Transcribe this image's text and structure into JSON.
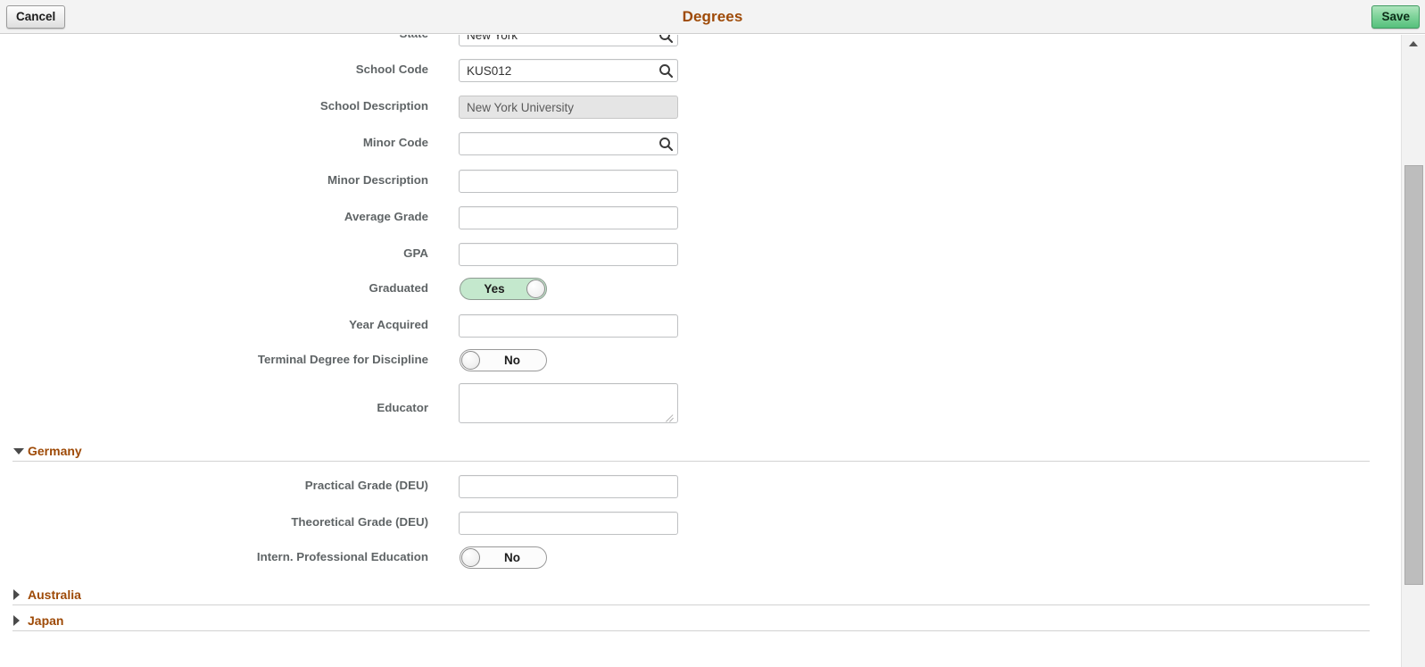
{
  "window": {
    "title": "Degrees",
    "cancel_label": "Cancel",
    "save_label": "Save"
  },
  "form": {
    "fields": [
      {
        "label": "State",
        "value": "New York",
        "type": "select",
        "partial": true
      },
      {
        "label": "School Code",
        "value": "KUS012",
        "type": "lookup"
      },
      {
        "label": "School Description",
        "value": "New York University",
        "type": "readonly"
      },
      {
        "label": "Minor Code",
        "value": "",
        "type": "lookup"
      },
      {
        "label": "Minor Description",
        "value": "",
        "type": "text"
      },
      {
        "label": "Average Grade",
        "value": "",
        "type": "text"
      },
      {
        "label": "GPA",
        "value": "",
        "type": "text"
      },
      {
        "label": "Graduated",
        "value": "Yes",
        "type": "toggle",
        "state": "on"
      },
      {
        "label": "Year Acquired",
        "value": "",
        "type": "text"
      },
      {
        "label": "Terminal Degree for Discipline",
        "value": "No",
        "type": "toggle",
        "state": "off"
      },
      {
        "label": "Educator",
        "value": "",
        "type": "textarea"
      }
    ]
  },
  "sections": [
    {
      "title": "Germany",
      "expanded": true,
      "fields": [
        {
          "label": "Practical Grade (DEU)",
          "value": "",
          "type": "text"
        },
        {
          "label": "Theoretical Grade (DEU)",
          "value": "",
          "type": "text"
        },
        {
          "label": "Intern. Professional Education",
          "value": "No",
          "type": "toggle",
          "state": "off"
        }
      ]
    },
    {
      "title": "Australia",
      "expanded": false,
      "fields": []
    },
    {
      "title": "Japan",
      "expanded": false,
      "fields": []
    }
  ],
  "icons": {
    "lookup": "search-icon",
    "scroll_up": "scroll-up-arrow-icon"
  },
  "colors": {
    "accent": "#9e4a07",
    "save_button": "#7fd39a",
    "toggle_on": "#c4e8cd",
    "label_text": "#5f6466"
  },
  "scrollbar": {
    "visible": true,
    "orientation": "vertical"
  }
}
